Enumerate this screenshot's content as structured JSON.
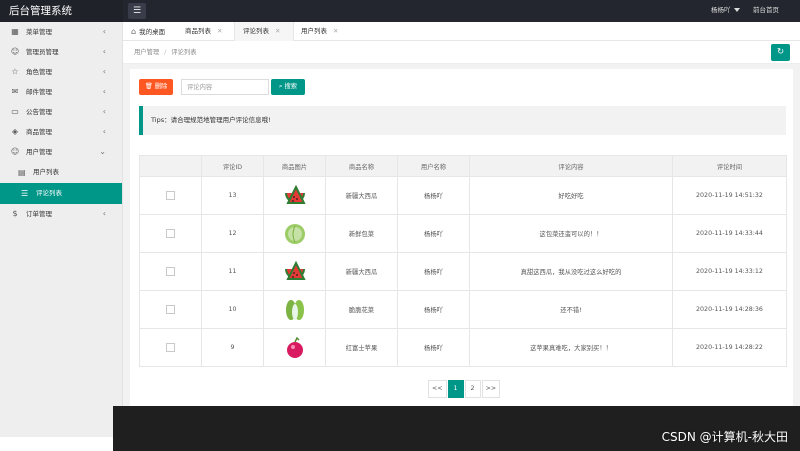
{
  "app": {
    "title": "后台管理系统"
  },
  "topbar": {
    "user": "杨杨吖",
    "home": "前台首页"
  },
  "sidebar": {
    "items": [
      {
        "label": "菜单管理",
        "icon": "grid-icon"
      },
      {
        "label": "管理员管理",
        "icon": "user-icon"
      },
      {
        "label": "角色管理",
        "icon": "star-icon"
      },
      {
        "label": "邮件管理",
        "icon": "mail-icon"
      },
      {
        "label": "公告管理",
        "icon": "notice-icon"
      },
      {
        "label": "商品管理",
        "icon": "layers-icon"
      },
      {
        "label": "用户管理",
        "icon": "user-icon"
      }
    ],
    "sub_items": [
      {
        "label": "用户列表",
        "icon": "doc-icon"
      },
      {
        "label": "评论列表",
        "icon": "list-icon"
      }
    ],
    "last_item": {
      "label": "订单管理",
      "icon": "dollar-icon"
    }
  },
  "tabs": [
    {
      "label": "我的桌面"
    },
    {
      "label": "商品列表"
    },
    {
      "label": "评论列表"
    },
    {
      "label": "用户列表"
    }
  ],
  "breadcrumb": {
    "parent": "用户管理",
    "separator": "/",
    "current": "评论列表"
  },
  "toolbar": {
    "delete_label": "删除",
    "search_placeholder": "评论内容",
    "search_label": "搜索"
  },
  "tips": "Tips：请合理规范地管理用户评论信息哦!",
  "table": {
    "headers": [
      "评论ID",
      "商品图片",
      "商品名称",
      "用户名称",
      "评论内容",
      "评论时间"
    ],
    "rows": [
      {
        "id": "13",
        "image": "watermelon",
        "product": "新疆大西瓜",
        "user": "杨杨吖",
        "content": "好吃好吃",
        "time": "2020-11-19 14:51:32"
      },
      {
        "id": "12",
        "image": "cabbage",
        "product": "新鲜包菜",
        "user": "杨杨吖",
        "content": "这包菜还蛮可以的！！",
        "time": "2020-11-19 14:33:44"
      },
      {
        "id": "11",
        "image": "watermelon",
        "product": "新疆大西瓜",
        "user": "杨杨吖",
        "content": "真甜这西瓜，我从没吃过这么好吃的",
        "time": "2020-11-19 14:33:12"
      },
      {
        "id": "10",
        "image": "bokchoy",
        "product": "脆脆花菜",
        "user": "杨杨吖",
        "content": "还不错!",
        "time": "2020-11-19 14:28:36"
      },
      {
        "id": "9",
        "image": "lychee",
        "product": "红富士苹果",
        "user": "杨杨吖",
        "content": "这苹果真难吃，大家别买！！",
        "time": "2020-11-19 14:28:22"
      }
    ]
  },
  "pager": {
    "prev": "<<",
    "pages": [
      "1",
      "2"
    ],
    "next": ">>",
    "current": "1"
  },
  "watermark": "CSDN @计算机-秋大田",
  "colors": {
    "accent": "#009688",
    "danger": "#ff5722",
    "topbar": "#23262e"
  }
}
